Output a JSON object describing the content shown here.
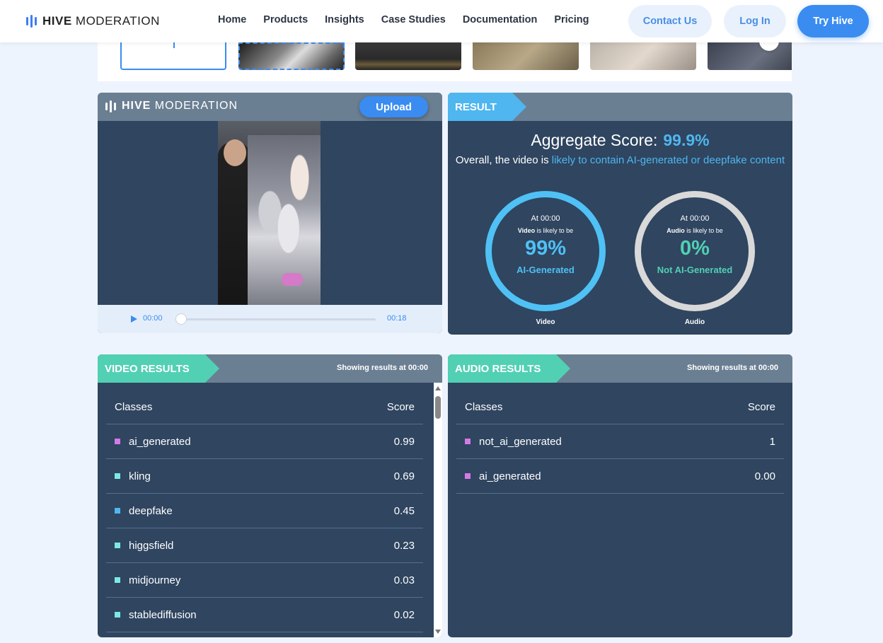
{
  "nav": {
    "logo_bold": "HIVE",
    "logo_light": "MODERATION",
    "menu": [
      "Home",
      "Products",
      "Insights",
      "Case Studies",
      "Documentation",
      "Pricing"
    ],
    "contact": "Contact Us",
    "login": "Log In",
    "try": "Try Hive"
  },
  "video_panel": {
    "logo_bold": "HIVE",
    "logo_light": "MODERATION",
    "upload": "Upload",
    "current_time": "00:00",
    "duration": "00:18",
    "progress": 0
  },
  "result": {
    "tag": "RESULT",
    "aggregate_label": "Aggregate Score:",
    "aggregate_value": "99.9%",
    "desc_prefix": "Overall, the video is",
    "desc_highlight": "likely to contain AI-generated or deepfake content",
    "video_ring": {
      "at": "At 00:00",
      "subject": "Video",
      "likely": "is likely to be",
      "pct": "99%",
      "label": "AI-Generated",
      "caption": "Video",
      "color": "#4fc1f5"
    },
    "audio_ring": {
      "at": "At 00:00",
      "subject": "Audio",
      "likely": "is likely to be",
      "pct": "0%",
      "label": "Not AI-Generated",
      "caption": "Audio",
      "color": "#52d0b3"
    }
  },
  "video_results": {
    "tag": "VIDEO RESULTS",
    "note_prefix": "Showing results at",
    "note_time": "00:00",
    "col_class": "Classes",
    "col_score": "Score",
    "rows": [
      {
        "cls": "ai_generated",
        "score": "0.99",
        "color": "#d47ae6"
      },
      {
        "cls": "kling",
        "score": "0.69",
        "color": "#7ce9e2"
      },
      {
        "cls": "deepfake",
        "score": "0.45",
        "color": "#4fb6ef"
      },
      {
        "cls": "higgsfield",
        "score": "0.23",
        "color": "#7ce9e2"
      },
      {
        "cls": "midjourney",
        "score": "0.03",
        "color": "#7ce9e2"
      },
      {
        "cls": "stablediffusion",
        "score": "0.02",
        "color": "#7ce9e2"
      }
    ]
  },
  "audio_results": {
    "tag": "AUDIO RESULTS",
    "note_prefix": "Showing results at",
    "note_time": "00:00",
    "col_class": "Classes",
    "col_score": "Score",
    "rows": [
      {
        "cls": "not_ai_generated",
        "score": "1",
        "color": "#d47ae6"
      },
      {
        "cls": "ai_generated",
        "score": "0.00",
        "color": "#d47ae6"
      }
    ]
  }
}
